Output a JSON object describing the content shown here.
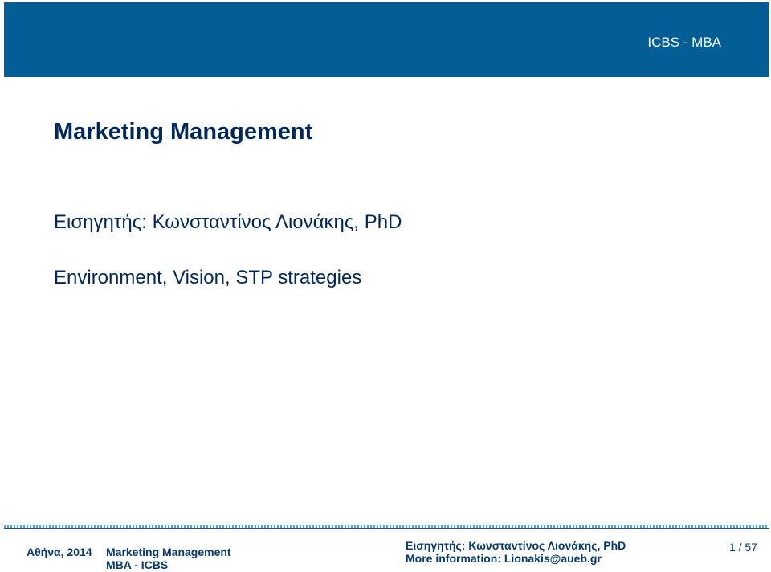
{
  "header": {
    "title": "ICBS - MBA",
    "color": "#035e95"
  },
  "slide": {
    "course_title": "Marketing Management",
    "lecturer": "Εισηγητής: Κωνσταντίνος Λιονάκης, PhD",
    "topic": "Environment, Vision, STP strategies",
    "text_color": "#00275a"
  },
  "footer": {
    "place_year": "Αθήνα, 2014",
    "course": "Marketing Management",
    "program": "MBA - ICBS",
    "lecturer": "Εισηγητής: Κωνσταντίνος Λιονάκης, PhD",
    "contact": "More information: Lionakis@aueb.gr",
    "page_counter": "1 / 57"
  }
}
